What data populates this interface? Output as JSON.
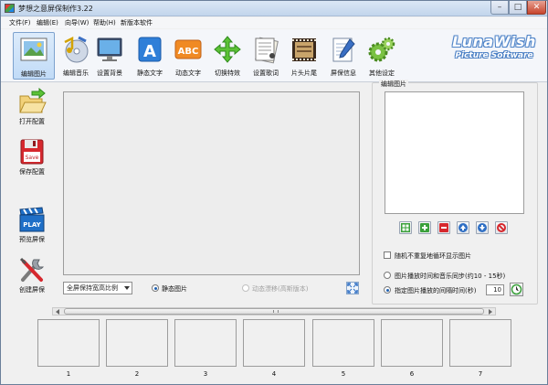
{
  "window": {
    "title": "梦想之意屏保制作3.22",
    "min": "–",
    "max": "□",
    "close": "✕"
  },
  "menu": [
    {
      "label": "文件(F)"
    },
    {
      "label": "编辑(E)"
    },
    {
      "label": "向导(W)"
    },
    {
      "label": "帮助(H)"
    },
    {
      "label": "新版本软件"
    }
  ],
  "toolbar": {
    "items": [
      {
        "label": "编辑图片",
        "icon": "picture-icon",
        "selected": true
      },
      {
        "label": "编辑音乐",
        "icon": "music-cd-icon"
      },
      {
        "label": "设置背景",
        "icon": "monitor-icon"
      },
      {
        "label": "静态文字",
        "icon": "letter-a-icon"
      },
      {
        "label": "动态文字",
        "icon": "abc-icon"
      },
      {
        "label": "切换特效",
        "icon": "arrows-icon"
      },
      {
        "label": "设置歌词",
        "icon": "lyrics-page-icon"
      },
      {
        "label": "片头片尾",
        "icon": "film-icon"
      },
      {
        "label": "屏保信息",
        "icon": "notepad-pen-icon"
      },
      {
        "label": "其他设定",
        "icon": "gears-icon"
      }
    ],
    "brand_title": "LunaWish",
    "brand_sub": "Picture Software"
  },
  "sidebar": {
    "items": [
      {
        "label": "打开配置",
        "icon": "open-folder-icon"
      },
      {
        "label": "保存配置",
        "icon": "floppy-save-icon"
      },
      {
        "label": "预览屏保",
        "icon": "play-clapper-icon"
      },
      {
        "label": "创建屏保",
        "icon": "tools-icon"
      }
    ],
    "save_badge": "Save",
    "play_badge": "PLAY"
  },
  "preview": {
    "fit_select": "全屏保持宽高比例",
    "mode_static": "静态图片",
    "mode_dynamic": "动态漂移(高斯版本)"
  },
  "edit_panel": {
    "title": "编辑图片",
    "random_label": "随机不重复地循环显示图片",
    "sync_label": "图片播放时间和音乐同步(约10 - 15秒)",
    "interval_label": "指定图片播放的间隔时间(秒)",
    "interval_value": "10"
  },
  "thumbnails": [
    "1",
    "2",
    "3",
    "4",
    "5",
    "6",
    "7"
  ]
}
